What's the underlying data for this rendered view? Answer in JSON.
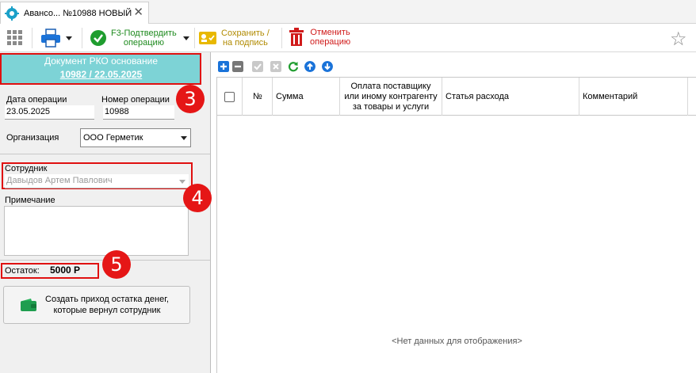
{
  "tab": {
    "title": "Авансо... №10988 НОВЫЙ",
    "icon": "gear-icon",
    "close_icon": "close-icon",
    "close_glyph": "✕"
  },
  "toolbar": {
    "confirm_label_1": "F3-Подтвердить",
    "confirm_label_2": "операцию",
    "save_label_1": "Сохранить /",
    "save_label_2": "на подпись",
    "cancel_label_1": "Отменить",
    "cancel_label_2": "операцию",
    "star_glyph": "☆"
  },
  "doc_header": {
    "title": "Документ РКО основание",
    "link": "10982 / 22.05.2025"
  },
  "form": {
    "date_label": "Дата операции",
    "date_value": "23.05.2025",
    "number_label": "Номер операции",
    "number_value": "10988",
    "org_label": "Организация",
    "org_value": "ООО Герметик",
    "employee_label": "Сотрудник",
    "employee_value": "Давыдов Артем Павлович",
    "note_label": "Примечание",
    "balance_label": "Остаток:",
    "balance_value": "5000 Р",
    "create_button_1": "Создать приход остатка денег,",
    "create_button_2": "которые вернул сотрудник"
  },
  "badges": {
    "b3": "3",
    "b4": "4",
    "b5": "5"
  },
  "grid": {
    "columns": [
      "№",
      "Сумма",
      "Оплата поставщику\nили иному контрагенту\nза товары и услуги",
      "Статья расхода",
      "Комментарий"
    ],
    "col_no": "№",
    "col_sum": "Сумма",
    "col_pay_1": "Оплата поставщику",
    "col_pay_2": "или иному контрагенту",
    "col_pay_3": "за товары и услуги",
    "col_article": "Статья расхода",
    "col_comment": "Комментарий",
    "empty": "<Нет данных для отображения>"
  },
  "colors": {
    "accent_teal": "#7dd3d6",
    "highlight_red": "#e01010",
    "confirm_green": "#1e8a1e",
    "save_gold": "#b08a00",
    "cancel_red": "#d01a1a",
    "blue": "#1a73d9"
  }
}
